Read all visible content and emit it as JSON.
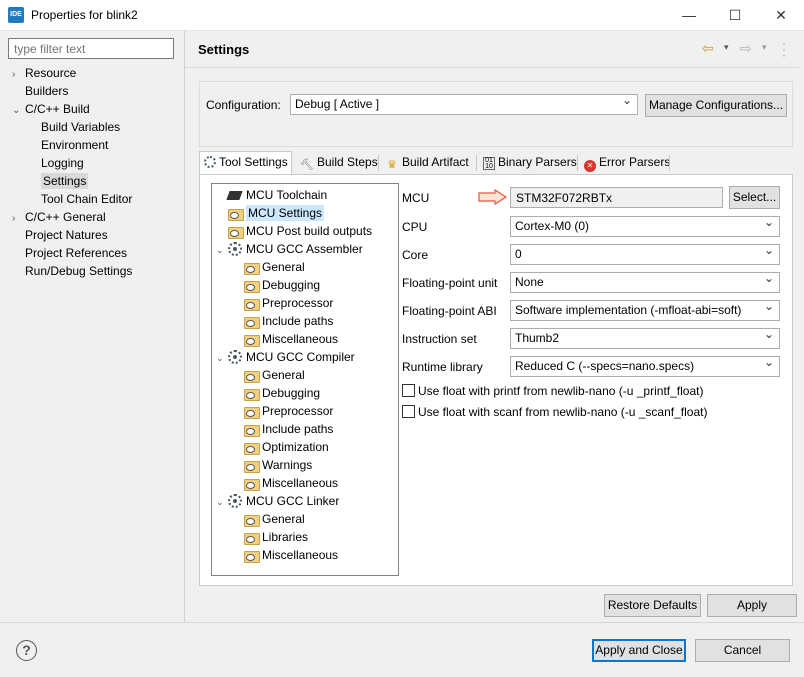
{
  "window": {
    "app_icon": "IDE",
    "title": "Properties for blink2",
    "controls": {
      "minimize": "—",
      "maximize": "☐",
      "close": "✕"
    }
  },
  "filter": {
    "placeholder": "type filter text"
  },
  "nav": {
    "resource": "Resource",
    "builders": "Builders",
    "cpp_build": "C/C++ Build",
    "build_variables": "Build Variables",
    "environment": "Environment",
    "logging": "Logging",
    "settings": "Settings",
    "tool_chain_editor": "Tool Chain Editor",
    "cpp_general": "C/C++ General",
    "project_natures": "Project Natures",
    "project_references": "Project References",
    "run_debug_settings": "Run/Debug Settings"
  },
  "page": {
    "title": "Settings"
  },
  "configuration": {
    "label": "Configuration:",
    "value": "Debug  [ Active ]",
    "manage_button": "Manage Configurations..."
  },
  "tabs": {
    "tool_settings": "Tool Settings",
    "build_steps": "Build Steps",
    "build_artifact": "Build Artifact",
    "binary_parsers": "Binary Parsers",
    "error_parsers": "Error Parsers"
  },
  "tree": {
    "mcu_toolchain": "MCU Toolchain",
    "mcu_settings": "MCU Settings",
    "mcu_post_build": "MCU Post build outputs",
    "assembler": "MCU GCC Assembler",
    "asm_general": "General",
    "asm_debugging": "Debugging",
    "asm_preprocessor": "Preprocessor",
    "asm_include_paths": "Include paths",
    "asm_misc": "Miscellaneous",
    "compiler": "MCU GCC Compiler",
    "cc_general": "General",
    "cc_debugging": "Debugging",
    "cc_preprocessor": "Preprocessor",
    "cc_include_paths": "Include paths",
    "cc_optimization": "Optimization",
    "cc_warnings": "Warnings",
    "cc_misc": "Miscellaneous",
    "linker": "MCU GCC Linker",
    "ld_general": "General",
    "ld_libraries": "Libraries",
    "ld_misc": "Miscellaneous"
  },
  "mcu": {
    "label": "MCU",
    "value": "STM32F072RBTx",
    "select_button": "Select..."
  },
  "props": {
    "cpu_label": "CPU",
    "cpu_value": "Cortex-M0 (0)",
    "core_label": "Core",
    "core_value": "0",
    "fpu_label": "Floating-point unit",
    "fpu_value": "None",
    "abi_label": "Floating-point ABI",
    "abi_value": "Software implementation (-mfloat-abi=soft)",
    "iset_label": "Instruction set",
    "iset_value": "Thumb2",
    "runtime_label": "Runtime library",
    "runtime_value": "Reduced C (--specs=nano.specs)",
    "printf_float": "Use float with printf from newlib-nano (-u _printf_float)",
    "scanf_float": "Use float with scanf from newlib-nano (-u _scanf_float)"
  },
  "buttons": {
    "restore_defaults": "Restore Defaults",
    "apply": "Apply",
    "apply_and_close": "Apply and Close",
    "cancel": "Cancel",
    "help": "?"
  },
  "colors": {
    "accent": "#0078d7",
    "selection": "#cce8ff",
    "arrow": "#e8543a"
  }
}
